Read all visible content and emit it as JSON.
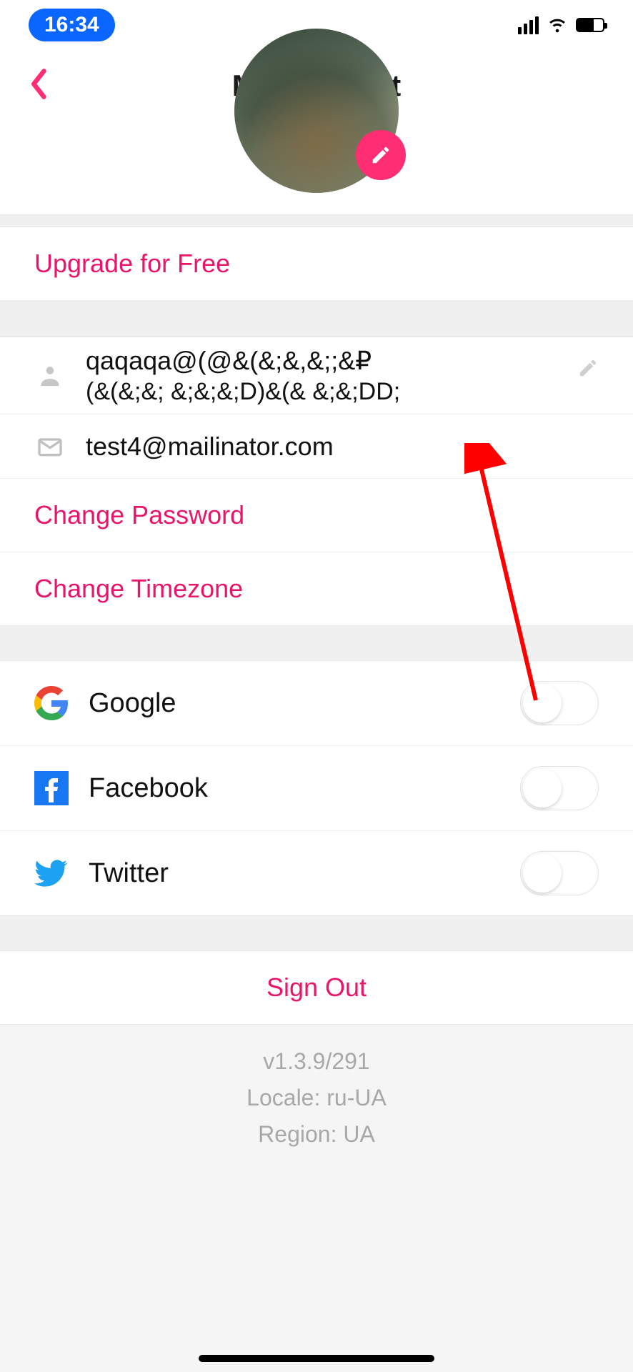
{
  "status_bar": {
    "time": "16:34"
  },
  "header": {
    "title": "My Account"
  },
  "upgrade": {
    "label": "Upgrade for Free"
  },
  "profile": {
    "username_line1": "qaqaqa@(@&(&;&,&;;&₽",
    "username_line2": "(&(&;&; &;&;&;D)&(& &;&;DD;",
    "email": "test4@mailinator.com"
  },
  "actions": {
    "change_password": "Change Password",
    "change_timezone": "Change Timezone",
    "sign_out": "Sign Out"
  },
  "social": {
    "google": "Google",
    "facebook": "Facebook",
    "twitter": "Twitter"
  },
  "footer": {
    "version": "v1.3.9/291",
    "locale": "Locale: ru-UA",
    "region": "Region: UA"
  }
}
